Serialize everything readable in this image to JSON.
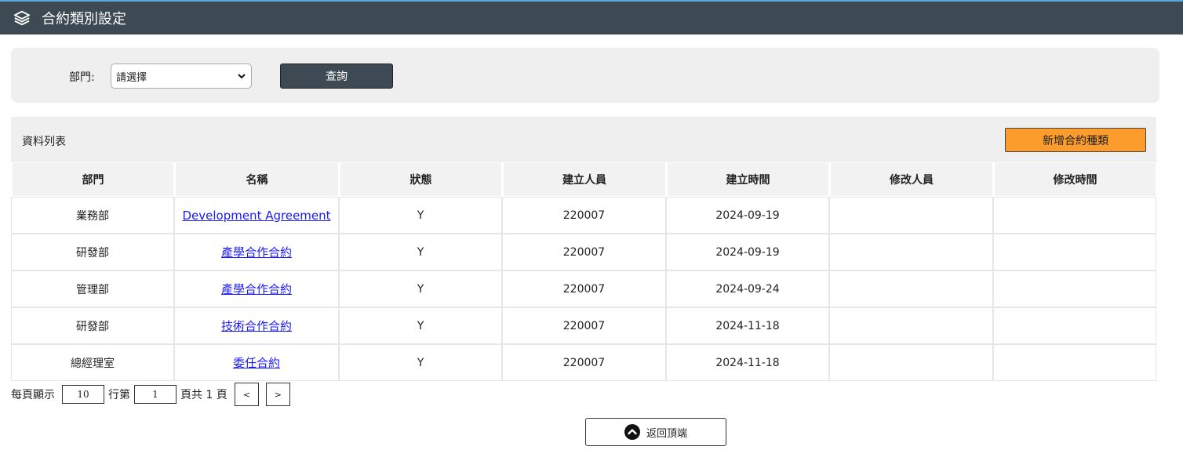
{
  "header": {
    "title": "合約類別設定",
    "icon": "layers-icon"
  },
  "filter": {
    "dept_label": "部門:",
    "dept_select_value": "請選擇",
    "query_label": "查詢"
  },
  "list": {
    "title": "資料列表",
    "add_label": "新增合約種類",
    "columns": [
      "部門",
      "名稱",
      "狀態",
      "建立人員",
      "建立時間",
      "修改人員",
      "修改時間"
    ],
    "rows": [
      {
        "dept": "業務部",
        "name": "Development Agreement",
        "status": "Y",
        "creator": "220007",
        "created": "2024-09-19",
        "modifier": "",
        "modified": ""
      },
      {
        "dept": "研發部",
        "name": "產學合作合約",
        "status": "Y",
        "creator": "220007",
        "created": "2024-09-19",
        "modifier": "",
        "modified": ""
      },
      {
        "dept": "管理部",
        "name": "產學合作合約",
        "status": "Y",
        "creator": "220007",
        "created": "2024-09-24",
        "modifier": "",
        "modified": ""
      },
      {
        "dept": "研發部",
        "name": "技術合作合約",
        "status": "Y",
        "creator": "220007",
        "created": "2024-11-18",
        "modifier": "",
        "modified": ""
      },
      {
        "dept": "總經理室",
        "name": "委任合約",
        "status": "Y",
        "creator": "220007",
        "created": "2024-11-18",
        "modifier": "",
        "modified": ""
      }
    ]
  },
  "pager": {
    "per_page_label": "每頁顯示",
    "per_page_value": "10",
    "rows_label": "行第",
    "page_value": "1",
    "page_total_text": "頁共 1 頁",
    "prev": "<",
    "next": ">"
  },
  "back_to_top": {
    "label": "返回頂端",
    "icon": "chevron-up-circle-icon"
  }
}
